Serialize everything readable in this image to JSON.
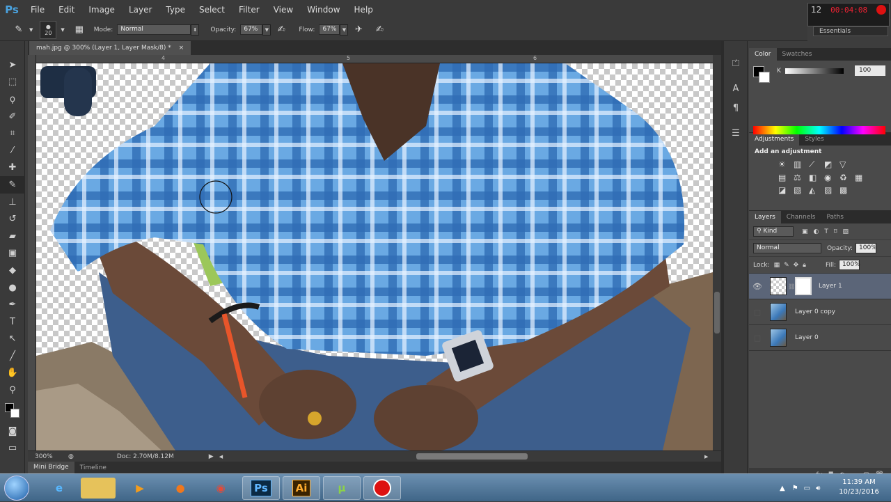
{
  "app": {
    "logo": "Ps"
  },
  "menu": [
    "File",
    "Edit",
    "Image",
    "Layer",
    "Type",
    "Select",
    "Filter",
    "View",
    "Window",
    "Help"
  ],
  "recorder": {
    "time": "00:04:08",
    "counter": "12"
  },
  "workspace": "Essentials",
  "options": {
    "brush_size": "20",
    "mode_label": "Mode:",
    "mode_value": "Normal",
    "opacity_label": "Opacity:",
    "opacity_value": "67%",
    "flow_label": "Flow:",
    "flow_value": "67%"
  },
  "document": {
    "tab_title": "mah.jpg @ 300% (Layer 1, Layer Mask/8) *",
    "zoom": "300%",
    "doc_size": "Doc: 2.70M/8.12M",
    "ruler_marks": [
      "4",
      "5",
      "6"
    ]
  },
  "bottom_tabs": [
    "Mini Bridge",
    "Timeline"
  ],
  "color_panel": {
    "tabs": [
      "Color",
      "Swatches"
    ],
    "k_label": "K",
    "k_value": "100",
    "colors": {
      "foreground": "#000000",
      "background": "#ffffff"
    }
  },
  "adjustments_panel": {
    "tabs": [
      "Adjustments",
      "Styles"
    ],
    "title": "Add an adjustment"
  },
  "layers_panel": {
    "tabs": [
      "Layers",
      "Channels",
      "Paths"
    ],
    "kind": "Kind",
    "blend_mode": "Normal",
    "opacity_label": "Opacity:",
    "opacity_value": "100%",
    "lock_label": "Lock:",
    "fill_label": "Fill:",
    "fill_value": "100%",
    "layers": [
      {
        "name": "Layer 1",
        "selected": true,
        "has_mask": true
      },
      {
        "name": "Layer 0 copy",
        "selected": false,
        "has_mask": false
      },
      {
        "name": "Layer 0",
        "selected": false,
        "has_mask": false
      }
    ]
  },
  "taskbar": {
    "apps": [
      "start",
      "internet-explorer",
      "file-explorer",
      "media-player",
      "firefox",
      "chrome",
      "photoshop",
      "illustrator",
      "utorrent",
      "recorder"
    ],
    "clock_time": "11:39 AM",
    "clock_date": "10/23/2016"
  }
}
